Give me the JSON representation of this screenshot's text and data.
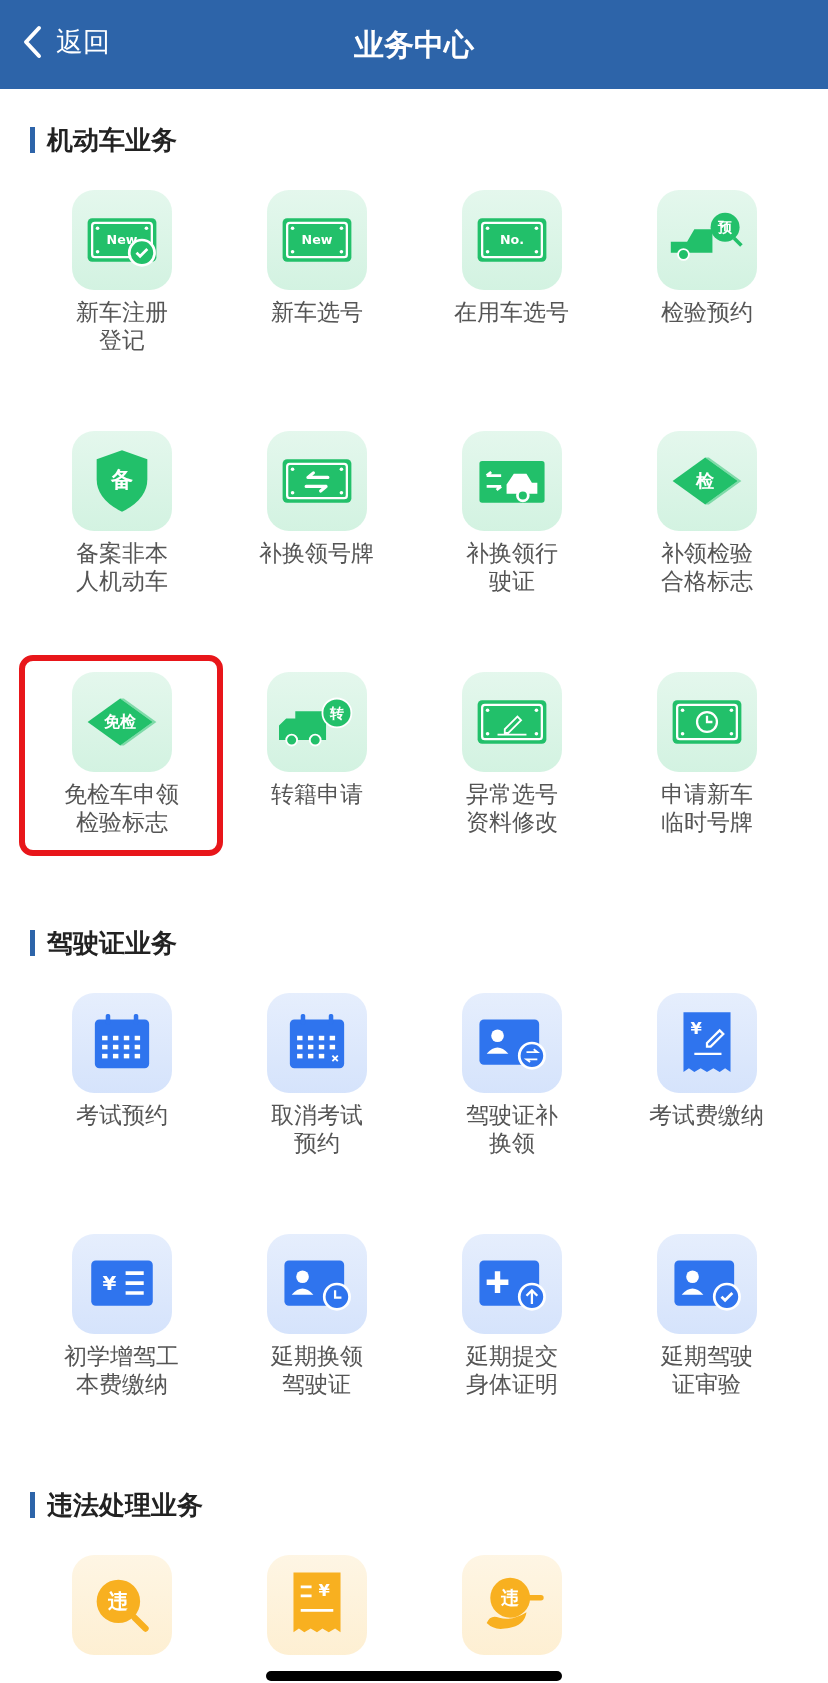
{
  "header": {
    "back_label": "返回",
    "title": "业务中心"
  },
  "sections": [
    {
      "title": "机动车业务",
      "color": "#22c06a",
      "items": [
        {
          "label_lines": [
            "新车注册",
            "登记"
          ],
          "kind": "plate-check",
          "icon_text": "New",
          "highlighted": false
        },
        {
          "label_lines": [
            "新车选号"
          ],
          "kind": "plate",
          "icon_text": "New",
          "highlighted": false
        },
        {
          "label_lines": [
            "在用车选号"
          ],
          "kind": "plate",
          "icon_text": "No.",
          "highlighted": false
        },
        {
          "label_lines": [
            "检验预约"
          ],
          "kind": "car-bubble",
          "icon_text": "预",
          "highlighted": false
        },
        {
          "label_lines": [
            "备案非本",
            "人机动车"
          ],
          "kind": "shield",
          "icon_text": "备",
          "highlighted": false
        },
        {
          "label_lines": [
            "补换领号牌"
          ],
          "kind": "plate-swap",
          "highlighted": false
        },
        {
          "label_lines": [
            "补换领行",
            "驶证"
          ],
          "kind": "car-swap",
          "highlighted": false
        },
        {
          "label_lines": [
            "补领检验",
            "合格标志"
          ],
          "kind": "diamond",
          "icon_text": "检",
          "highlighted": false
        },
        {
          "label_lines": [
            "免检车申领",
            "检验标志"
          ],
          "kind": "diamond",
          "icon_text": "免检",
          "highlighted": true
        },
        {
          "label_lines": [
            "转籍申请"
          ],
          "kind": "truck-bubble",
          "icon_text": "转",
          "highlighted": false
        },
        {
          "label_lines": [
            "异常选号",
            "资料修改"
          ],
          "kind": "plate-pen",
          "highlighted": false
        },
        {
          "label_lines": [
            "申请新车",
            "临时号牌"
          ],
          "kind": "plate-clock",
          "highlighted": false
        }
      ]
    },
    {
      "title": "驾驶证业务",
      "color": "#2f74ee",
      "items": [
        {
          "label_lines": [
            "考试预约"
          ],
          "kind": "calendar",
          "highlighted": false
        },
        {
          "label_lines": [
            "取消考试",
            "预约"
          ],
          "kind": "calendar-x",
          "highlighted": false
        },
        {
          "label_lines": [
            "驾驶证补",
            "换领"
          ],
          "kind": "card-swap",
          "highlighted": false
        },
        {
          "label_lines": [
            "考试费缴纳"
          ],
          "kind": "receipt-pen",
          "icon_text": "¥",
          "highlighted": false
        },
        {
          "label_lines": [
            "初学增驾工",
            "本费缴纳"
          ],
          "kind": "list-yen",
          "icon_text": "¥",
          "highlighted": false
        },
        {
          "label_lines": [
            "延期换领",
            "驾驶证"
          ],
          "kind": "card-clock",
          "highlighted": false
        },
        {
          "label_lines": [
            "延期提交",
            "身体证明"
          ],
          "kind": "plus-up",
          "highlighted": false
        },
        {
          "label_lines": [
            "延期驾驶",
            "证审验"
          ],
          "kind": "card-check",
          "highlighted": false
        }
      ]
    },
    {
      "title": "违法处理业务",
      "color": "#f8b020",
      "items": [
        {
          "kind": "magnify",
          "icon_text": "违",
          "highlighted": false
        },
        {
          "kind": "receipt-yen",
          "icon_text": "¥",
          "highlighted": false
        },
        {
          "kind": "hand-bubble",
          "icon_text": "违",
          "highlighted": false
        }
      ]
    }
  ]
}
